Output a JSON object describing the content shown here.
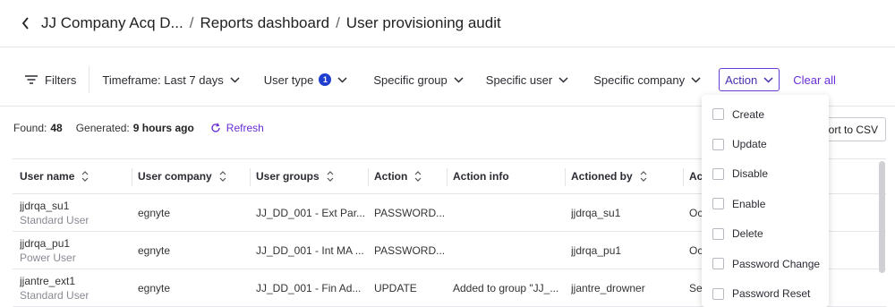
{
  "breadcrumb": {
    "company": "JJ Company Acq D...",
    "reports": "Reports dashboard",
    "current": "User provisioning audit",
    "separator": "/"
  },
  "filters": {
    "filters_label": "Filters",
    "timeframe": "Timeframe: Last 7 days",
    "user_type": "User type",
    "user_type_count": "1",
    "specific_group": "Specific group",
    "specific_user": "Specific user",
    "specific_company": "Specific company",
    "action": "Action",
    "clear_all": "Clear all"
  },
  "info": {
    "found_label": "Found:",
    "found_count": "48",
    "generated_label": "Generated:",
    "generated_value": "9 hours ago",
    "refresh": "Refresh",
    "export": "port to CSV"
  },
  "table": {
    "headers": [
      "User name",
      "User company",
      "User groups",
      "Action",
      "Action info",
      "Actioned by",
      "Ac"
    ],
    "rows": [
      {
        "name": "jjdrqa_su1",
        "type": "Standard User",
        "company": "egnyte",
        "groups": "JJ_DD_001 - Ext Par...",
        "action": "PASSWORD...",
        "info": "",
        "by": "jjdrqa_su1",
        "date": "Oc"
      },
      {
        "name": "jjdrqa_pu1",
        "type": "Power User",
        "company": "egnyte",
        "groups": "JJ_DD_001 - Int MA ...",
        "action": "PASSWORD...",
        "info": "",
        "by": "jjdrqa_pu1",
        "date": "Oc"
      },
      {
        "name": "jjantre_ext1",
        "type": "Standard User",
        "company": "egnyte",
        "groups": "JJ_DD_001 - Fin Ad...",
        "action": "UPDATE",
        "info": "Added to group \"JJ_...",
        "by": "jjantre_drowner",
        "date": "Se"
      }
    ]
  },
  "action_menu": {
    "items": [
      "Create",
      "Update",
      "Disable",
      "Enable",
      "Delete",
      "Password Change",
      "Password Reset"
    ]
  },
  "colors": {
    "accent": "#6a2ed6",
    "badge": "#1f3ecf"
  }
}
